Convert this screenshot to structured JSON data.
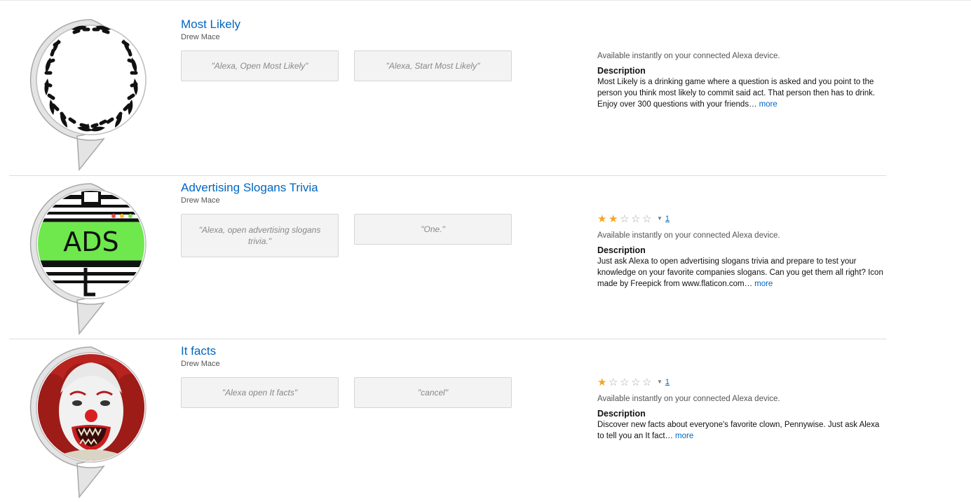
{
  "skills": [
    {
      "title": "Most Likely",
      "author": "Drew Mace",
      "utterances": [
        "\"Alexa, Open Most Likely\"",
        "\"Alexa, Start Most Likely\""
      ],
      "rating": null,
      "availability": "Available instantly on your connected Alexa device.",
      "description_heading": "Description",
      "description": "Most Likely is a drinking game where a question is asked and you point to the person you think most likely to commit said act. That person then has to drink. Enjoy over 300 questions with your friends…",
      "more_label": "more",
      "icon": "laurel-wreath-icon"
    },
    {
      "title": "Advertising Slogans Trivia",
      "author": "Drew Mace",
      "utterances": [
        "\"Alexa, open advertising slogans trivia.\"",
        "\"One.\""
      ],
      "rating": {
        "stars": 2,
        "max": 5,
        "count": "1"
      },
      "availability": "Available instantly on your connected Alexa device.",
      "description_heading": "Description",
      "description": "Just ask Alexa to open advertising slogans trivia and prepare to test your knowledge on your favorite companies slogans. Can you get them all right? Icon made by Freepick from www.flaticon.com…",
      "more_label": "more",
      "icon": "billboard-icon",
      "icon_text": "ADS"
    },
    {
      "title": "It facts",
      "author": "Drew Mace",
      "utterances": [
        "\"Alexa open It facts\"",
        "\"cancel\""
      ],
      "rating": {
        "stars": 1,
        "max": 5,
        "count": "1"
      },
      "availability": "Available instantly on your connected Alexa device.",
      "description_heading": "Description",
      "description": "Discover new facts about everyone's favorite clown, Pennywise. Just ask Alexa to tell you an It fact…",
      "more_label": "more",
      "icon": "clown-face-icon"
    }
  ],
  "colors": {
    "link": "#0066c0",
    "star": "#f4a41d",
    "utterance_bg": "#f3f3f3",
    "ads_green": "#6ee84d"
  }
}
